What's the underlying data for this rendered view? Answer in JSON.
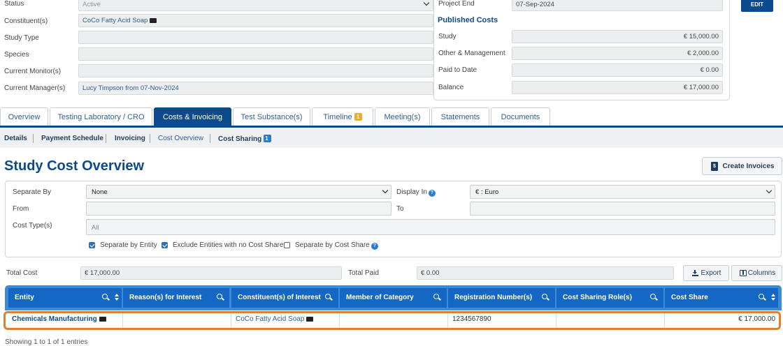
{
  "details_left": {
    "status": {
      "label": "Status",
      "value": "Active"
    },
    "constituents": {
      "label": "Constituent(s)",
      "value": "CoCo Fatty Acid Soap"
    },
    "study_type": {
      "label": "Study Type",
      "value": ""
    },
    "species": {
      "label": "Species",
      "value": ""
    },
    "current_monitor": {
      "label": "Current Monitor(s)",
      "value": ""
    },
    "current_manager": {
      "label": "Current Manager(s)",
      "value": "Lucy Timpson from 07-Nov-2024"
    }
  },
  "details_right": {
    "project_end": {
      "label": "Project End",
      "value": "07-Sep-2024"
    },
    "published_costs_heading": "Published Costs",
    "study": {
      "label": "Study",
      "value": "€ 15,000.00"
    },
    "other_management": {
      "label": "Other & Management",
      "value": "€ 2,000.00"
    },
    "paid_to_date": {
      "label": "Paid to Date",
      "value": "€ 0.00"
    },
    "balance": {
      "label": "Balance",
      "value": "€ 17,000.00"
    },
    "edit_label": "EDIT"
  },
  "tabs": [
    {
      "label": "Overview"
    },
    {
      "label": "Testing Laboratory / CRO"
    },
    {
      "label": "Costs & Invoicing",
      "active": true
    },
    {
      "label": "Test Substance(s)"
    },
    {
      "label": "Timeline",
      "badge": "1"
    },
    {
      "label": "Meeting(s)"
    },
    {
      "label": "Statements"
    },
    {
      "label": "Documents"
    }
  ],
  "subnav": [
    {
      "label": "Details"
    },
    {
      "label": "Payment Schedule"
    },
    {
      "label": "Invoicing"
    },
    {
      "label": "Cost Overview",
      "active": true
    },
    {
      "label": "Cost Sharing",
      "badge": "1"
    }
  ],
  "page_title": "Study Cost Overview",
  "create_invoices_label": "Create Invoices",
  "filters": {
    "separate_by": {
      "label": "Separate By",
      "value": "None"
    },
    "display_in": {
      "label": "Display In",
      "value": "€ : Euro"
    },
    "from": {
      "label": "From",
      "value": ""
    },
    "to": {
      "label": "To",
      "value": ""
    },
    "cost_types": {
      "label": "Cost Type(s)",
      "value": "All"
    },
    "separate_by_entity": {
      "label": "Separate by Entity",
      "checked": true
    },
    "exclude_entities": {
      "label": "Exclude Entities with no Cost Share",
      "checked": true
    },
    "separate_by_cost_share": {
      "label": "Separate by Cost Share",
      "checked": false
    }
  },
  "totals": {
    "total_cost": {
      "label": "Total Cost",
      "value": "€ 17,000.00"
    },
    "total_paid": {
      "label": "Total Paid",
      "value": "€ 0.00"
    }
  },
  "export_label": "Export",
  "columns_label": "Columns",
  "table": {
    "headers": [
      "Entity",
      "Reason(s) for Interest",
      "Constituent(s) of Interest",
      "Member of Category",
      "Registration Number(s)",
      "Cost Sharing Role(s)",
      "Cost Share"
    ],
    "rows": [
      {
        "entity": "Chemicals Manufacturing",
        "reasons": "",
        "constituents": "CoCo Fatty Acid Soap",
        "member_of_category": "",
        "registration_numbers": "1234567890",
        "cost_sharing_roles": "",
        "cost_share": "€ 17,000.00"
      }
    ]
  },
  "footer": "Showing 1 to 1 of 1 entries",
  "colors": {
    "primary": "#0c4a8d",
    "header_blue": "#1467c5",
    "highlight": "#e07f2e",
    "badge_orange": "#f0a830"
  }
}
